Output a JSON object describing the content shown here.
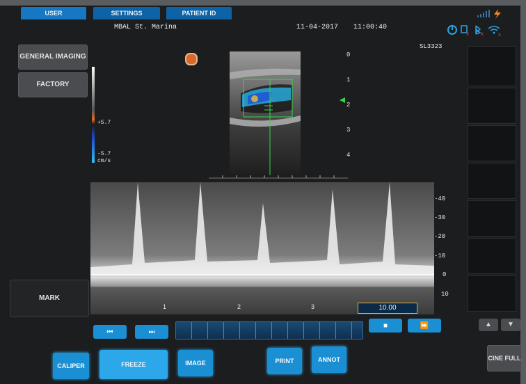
{
  "tabs": [
    "USER",
    "SETTINGS",
    "PATIENT ID"
  ],
  "header": {
    "facility": "MBAL St. Marina",
    "date": "11-04-2017",
    "time": "11:00:40",
    "probe": "SL3323"
  },
  "left_buttons": {
    "general_imaging": "GENERAL IMAGING",
    "factory": "FACTORY",
    "mark": "MARK"
  },
  "color_scale": {
    "max_label": "+5.7",
    "min_label": "-5.7",
    "unit": "cm/s"
  },
  "depth_labels": [
    "0",
    "1",
    "2",
    "3",
    "4"
  ],
  "velocity_labels": [
    "-40",
    "-30",
    "-20",
    "-10",
    "0",
    "10"
  ],
  "time_labels": [
    "1",
    "2",
    "3"
  ],
  "sweep_readout": "10.00",
  "bottom_buttons": {
    "caliper": "CALIPER",
    "freeze": "FREEZE",
    "image": "IMAGE",
    "print": "PRINT",
    "annot": "ANNOT",
    "cine_full": "CINE FULL"
  },
  "icons": [
    "power-icon",
    "usb-icon",
    "bluetooth-icon",
    "wifi-icon",
    "battery-icon",
    "lightning-icon",
    "skip-back-icon",
    "skip-forward-icon",
    "stop-icon",
    "play-forward-icon",
    "arrow-up-icon",
    "arrow-down-icon",
    "record-icon"
  ],
  "colors": {
    "tab_blue": "#0e63a6",
    "button_blue": "#1a8fd4",
    "doppler_cyan": "#27b3e6",
    "doppler_green": "#38d64a",
    "highlight_yellow": "#e2b93b"
  }
}
